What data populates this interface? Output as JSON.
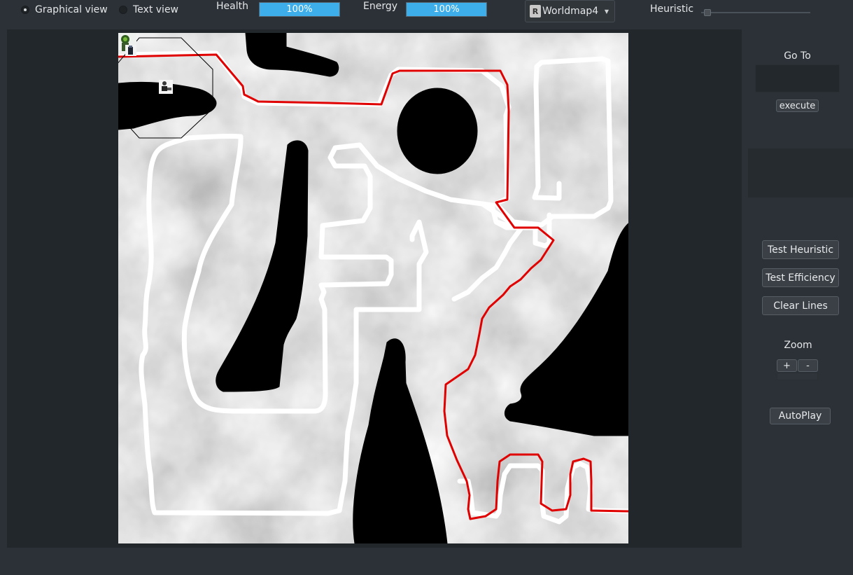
{
  "toolbar": {
    "view_graphical": "Graphical view",
    "view_text": "Text view",
    "selected_view": "graphical",
    "health_label": "Health",
    "health_text": "100%",
    "health_value": 1.0,
    "energy_label": "Energy",
    "energy_text": "100%",
    "energy_value": 1.0,
    "world_selected": "Worldmap4",
    "heuristic_label": "Heuristic",
    "heuristic_value": 0.0
  },
  "panel": {
    "goto_label": "Go To",
    "execute_label": "execute",
    "test_heuristic": "Test Heuristic",
    "test_efficiency": "Test Efficiency",
    "clear_lines": "Clear Lines",
    "zoom_label": "Zoom",
    "zoom_in": "+",
    "zoom_out": "-",
    "autoplay": "AutoPlay"
  },
  "map": {
    "icons": [
      "protagonist-icon",
      "enemy-icon",
      "poisoned-enemy-icon"
    ],
    "path_color": "#e00000",
    "wall_line_color": "#ffffff",
    "accent": "#3daee9"
  }
}
